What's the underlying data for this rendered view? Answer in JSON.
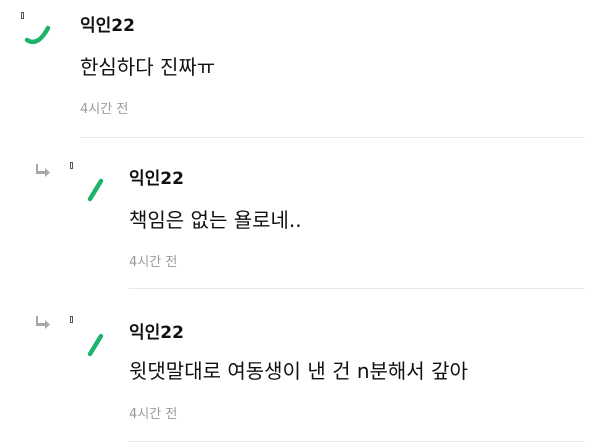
{
  "comments": [
    {
      "username": "익인22",
      "text": "한심하다 진짜ㅠ",
      "time": "4시간 전",
      "is_reply": false
    },
    {
      "username": "익인22",
      "text": "책임은 없는 욜로네..",
      "time": "4시간 전",
      "is_reply": true
    },
    {
      "username": "익인22",
      "text": "윗댓말대로 여동생이 낸 건 n분해서 갚아",
      "time": "4시간 전",
      "is_reply": true
    }
  ],
  "colors": {
    "avatar_green": "#1db36b",
    "meta_gray": "#9a9a9a",
    "divider": "#e9e9e9",
    "reply_arrow": "#a8a8a8"
  },
  "icons": {
    "reply": "reply-arrow-icon",
    "avatar": "green-stroke-avatar-icon"
  }
}
